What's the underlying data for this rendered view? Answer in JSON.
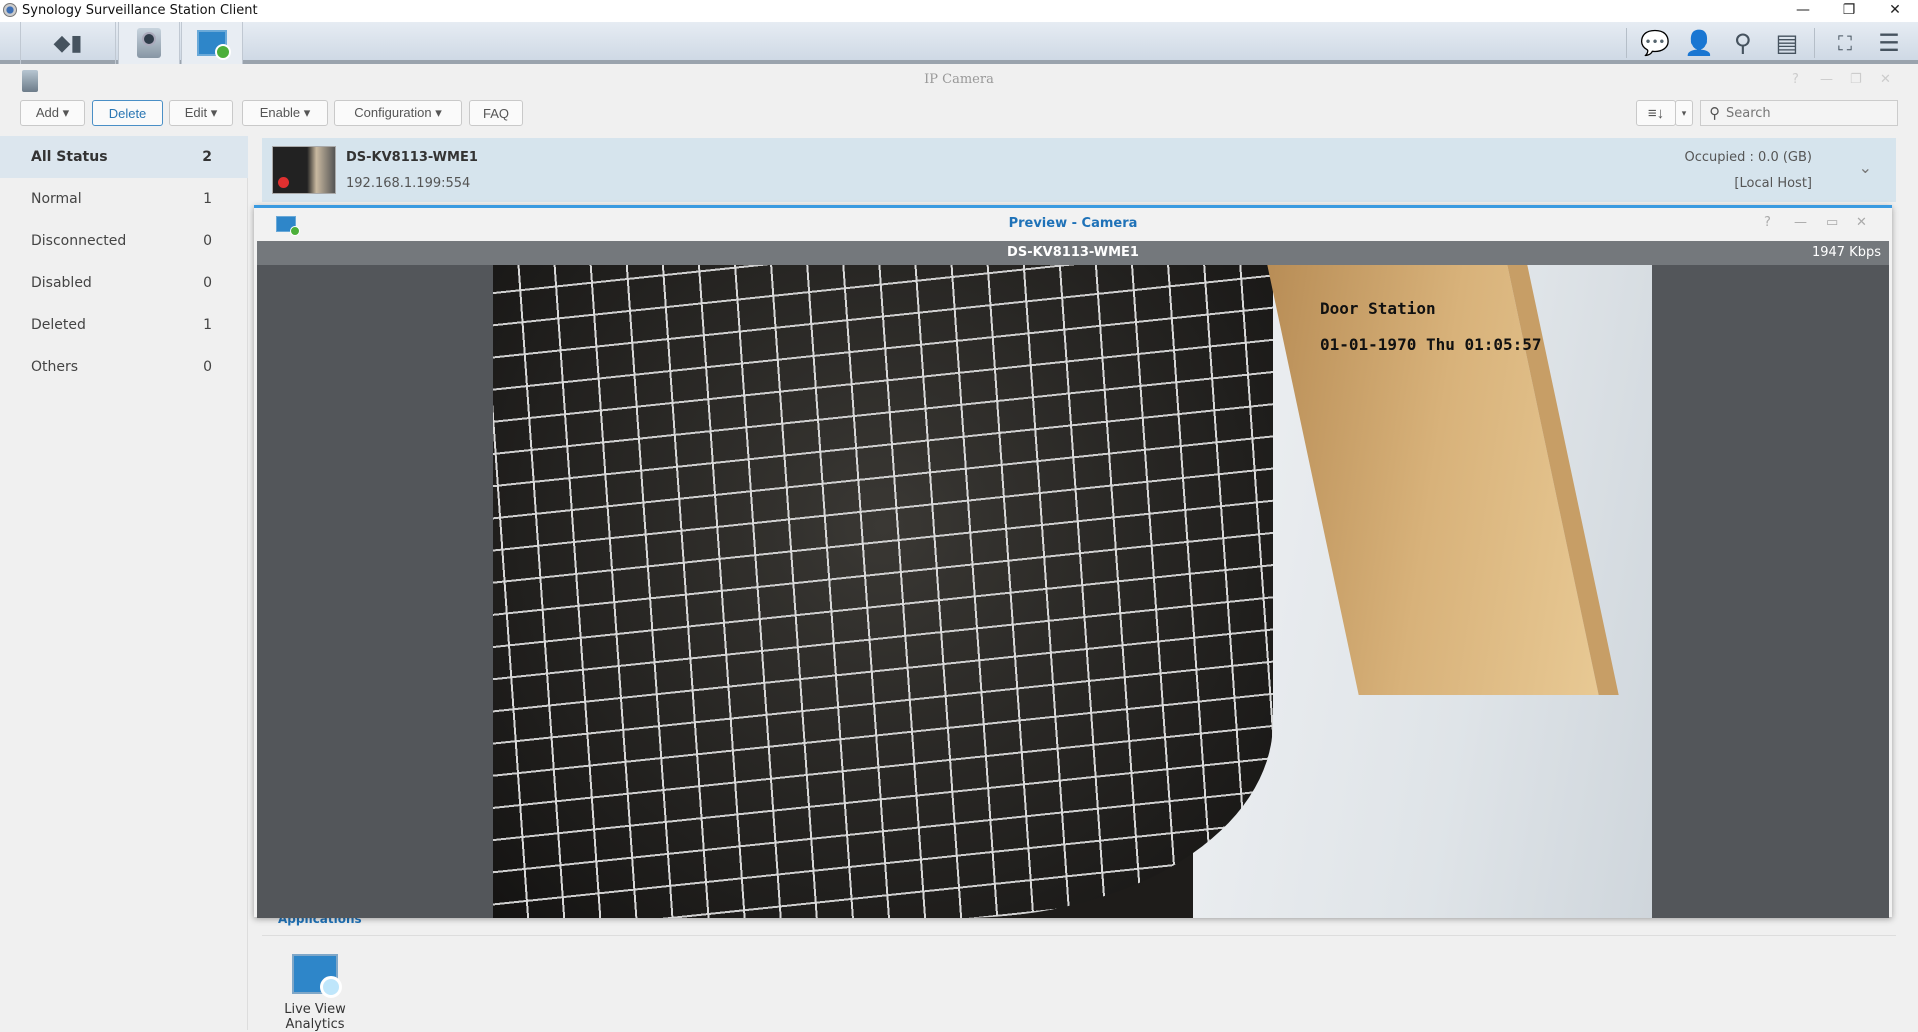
{
  "app": {
    "title": "Synology Surveillance Station Client"
  },
  "window_controls": {
    "minimize": "—",
    "restore": "❐",
    "close": "✕"
  },
  "topbar": {
    "tabs": [
      {
        "icon": "main-menu-icon"
      },
      {
        "icon": "ip-camera-icon"
      },
      {
        "icon": "live-view-icon"
      }
    ],
    "right_icons": [
      "notification-icon",
      "user-icon",
      "search-icon",
      "info-card-icon",
      "fullscreen-icon",
      "menu-icon"
    ]
  },
  "window": {
    "title": "IP Camera",
    "controls": {
      "help": "?",
      "minimize": "—",
      "restore": "❐",
      "close": "✕"
    }
  },
  "toolbar": {
    "add": "Add ▾",
    "delete": "Delete",
    "edit": "Edit ▾",
    "enable": "Enable ▾",
    "configuration": "Configuration ▾",
    "faq": "FAQ",
    "sort": "≡↓",
    "search_placeholder": "Search"
  },
  "sidebar": {
    "items": [
      {
        "label": "All Status",
        "count": "2",
        "selected": true
      },
      {
        "label": "Normal",
        "count": "1"
      },
      {
        "label": "Disconnected",
        "count": "0"
      },
      {
        "label": "Disabled",
        "count": "0"
      },
      {
        "label": "Deleted",
        "count": "1"
      },
      {
        "label": "Others",
        "count": "0"
      }
    ]
  },
  "camera": {
    "name": "DS-KV8113-WME1",
    "address": "192.168.1.199:554",
    "occupied": "Occupied : 0.0 (GB)",
    "host": "[Local Host]",
    "recording_color": "#e03030"
  },
  "preview": {
    "title": "Preview - Camera",
    "controls": {
      "help": "?",
      "minimize": "—",
      "maximize": "▭",
      "close": "✕"
    },
    "stream_name": "DS-KV8113-WME1",
    "bitrate": "1947 Kbps",
    "osd_line1": "Door Station",
    "osd_line2": "01-01-1970 Thu 01:05:57"
  },
  "applications": {
    "tab": "Applications",
    "items": [
      {
        "label": "Live View Analytics",
        "icon": "live-view-analytics-icon"
      }
    ]
  },
  "colors": {
    "accent": "#3a9ae0",
    "selected_row": "#d6e4ed",
    "title_blue": "#1f72b8"
  }
}
